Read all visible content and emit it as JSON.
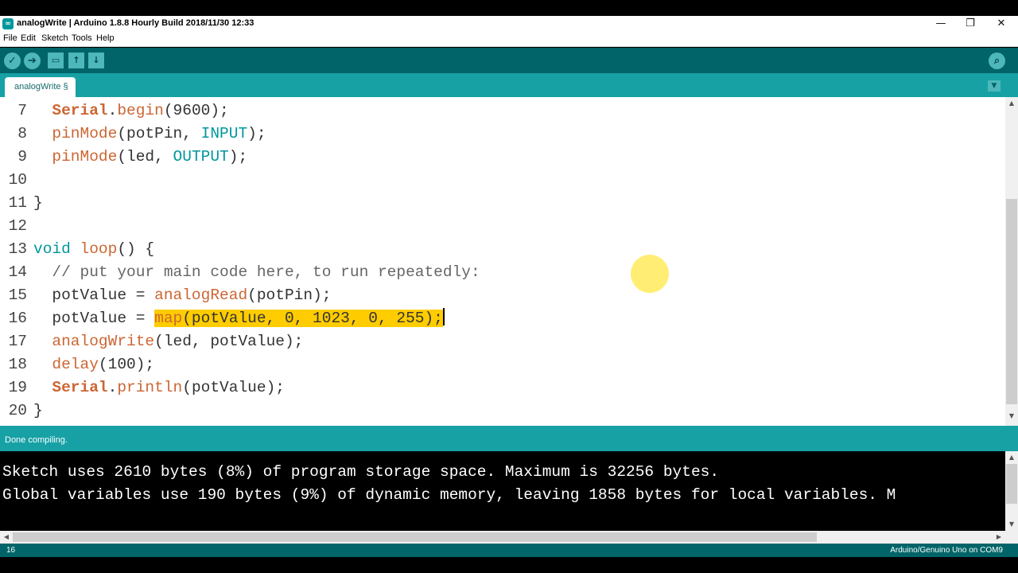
{
  "window": {
    "title": "analogWrite | Arduino 1.8.8 Hourly Build 2018/11/30 12:33",
    "app_icon": "arduino-infinity-icon",
    "controls": {
      "minimize": "—",
      "restore": "❐",
      "close": "✕"
    }
  },
  "menu": [
    "File",
    "Edit",
    "Sketch",
    "Tools",
    "Help"
  ],
  "toolbar": {
    "verify": "✓",
    "upload": "➔",
    "new": "▭",
    "open": "↑",
    "save": "↓",
    "serial_monitor": "⌕"
  },
  "tabs": {
    "active": "analogWrite §",
    "menu_icon": "▼"
  },
  "editor": {
    "lines": [
      {
        "n": "7",
        "t": "  Serial.begin(9600);"
      },
      {
        "n": "8",
        "t": "  pinMode(potPin, INPUT);"
      },
      {
        "n": "9",
        "t": "  pinMode(led, OUTPUT);"
      },
      {
        "n": "10",
        "t": ""
      },
      {
        "n": "11",
        "t": "}"
      },
      {
        "n": "12",
        "t": ""
      },
      {
        "n": "13",
        "t": "void loop() {"
      },
      {
        "n": "14",
        "t": "  // put your main code here, to run repeatedly:"
      },
      {
        "n": "15",
        "t": "  potValue = analogRead(potPin);"
      },
      {
        "n": "16",
        "t": "  potValue = map(potValue, 0, 1023, 0, 255);"
      },
      {
        "n": "17",
        "t": "  analogWrite(led, potValue);"
      },
      {
        "n": "18",
        "t": "  delay(100);"
      },
      {
        "n": "19",
        "t": "  Serial.println(potValue);"
      },
      {
        "n": "20",
        "t": "}"
      }
    ],
    "selection": "map(potValue, 0, 1023, 0, 255);"
  },
  "status": {
    "message": "Done compiling."
  },
  "console": {
    "lines": [
      "Sketch uses 2610 bytes (8%) of program storage space. Maximum is 32256 bytes.",
      "Global variables use 190 bytes (9%) of dynamic memory, leaving 1858 bytes for local variables. M"
    ]
  },
  "footer": {
    "line_number": "16",
    "board": "Arduino/Genuino Uno on COM9"
  },
  "colors": {
    "toolbar": "#006468",
    "tabbar": "#17a1a5",
    "keyword": "#cc6633",
    "type": "#00979c",
    "highlight": "#ffcc00"
  }
}
